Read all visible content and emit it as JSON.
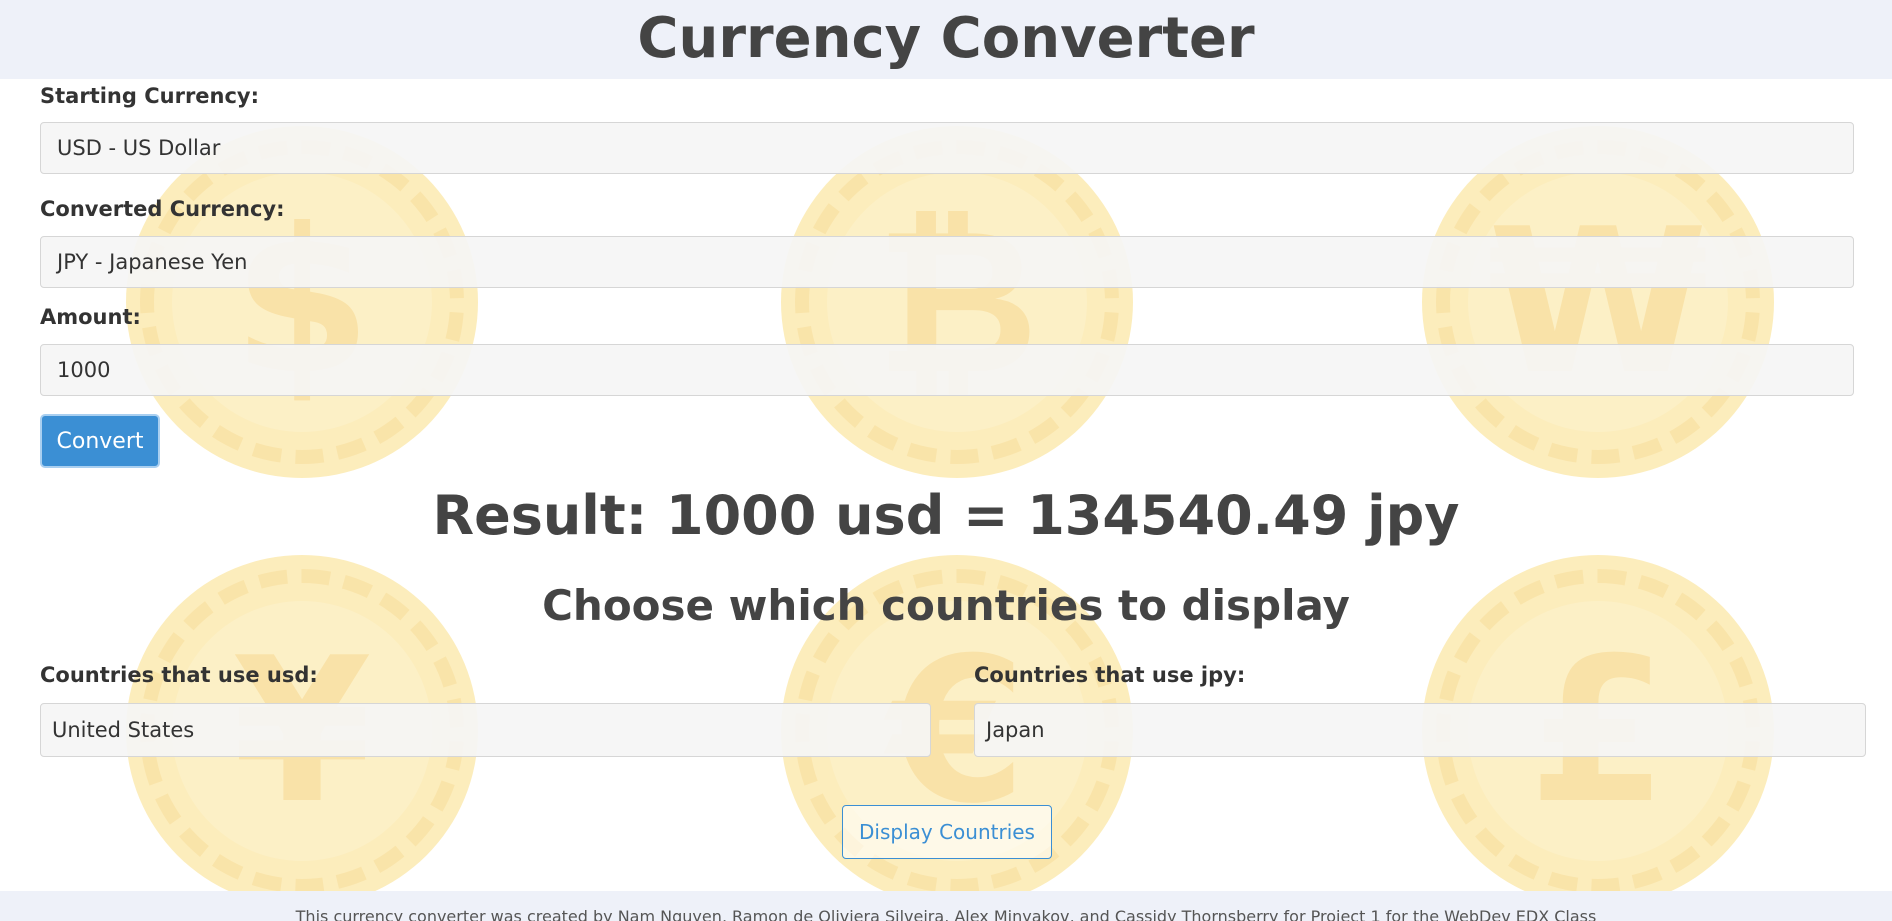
{
  "header": {
    "title": "Currency Converter"
  },
  "form": {
    "starting_label": "Starting Currency:",
    "starting_value": "USD - US Dollar",
    "converted_label": "Converted Currency:",
    "converted_value": "JPY - Japanese Yen",
    "amount_label": "Amount:",
    "amount_value": "1000",
    "convert_button": "Convert"
  },
  "result": {
    "text": "Result: 1000 usd = 134540.49 jpy"
  },
  "countries": {
    "heading": "Choose which countries to display",
    "from_label": "Countries that use usd:",
    "from_value": "United States",
    "to_label": "Countries that use jpy:",
    "to_value": "Japan",
    "display_button": "Display Countries"
  },
  "footer": {
    "text": "This currency converter was created by Nam Nguyen, Ramon de Oliviera Silveira, Alex Minyakov, and Cassidy Thornsberry for Project 1 for the WebDev EDX Class"
  },
  "background": {
    "coins": [
      {
        "icon": "dollar-coin-icon",
        "glyph": "$"
      },
      {
        "icon": "bitcoin-coin-icon",
        "glyph": "₿"
      },
      {
        "icon": "won-coin-icon",
        "glyph": "₩"
      },
      {
        "icon": "yen-coin-icon",
        "glyph": "¥"
      },
      {
        "icon": "euro-coin-icon",
        "glyph": "€"
      },
      {
        "icon": "pound-coin-icon",
        "glyph": "£"
      }
    ]
  },
  "colors": {
    "header_bg": "#eef1f9",
    "primary": "#3b8fd4",
    "coin": "#fbe7a6"
  }
}
